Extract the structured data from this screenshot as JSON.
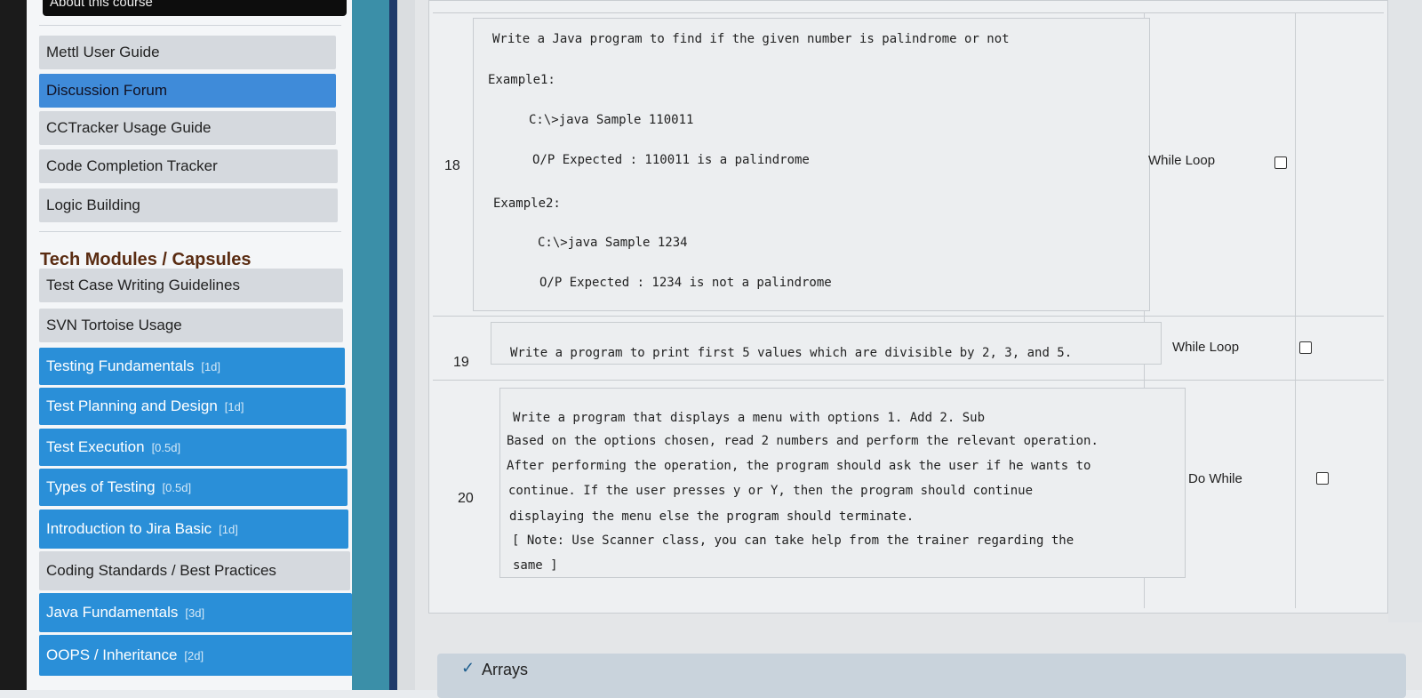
{
  "sidebar": {
    "about_label": "About this course",
    "items": [
      {
        "label": "Mettl User Guide",
        "tag": ""
      },
      {
        "label": "Discussion Forum",
        "tag": ""
      },
      {
        "label": "CCTracker Usage Guide",
        "tag": ""
      },
      {
        "label": "Code Completion Tracker",
        "tag": ""
      },
      {
        "label": "Logic Building",
        "tag": ""
      }
    ],
    "section_title": "Tech Modules / Capsules",
    "modules": [
      {
        "label": "Test Case Writing Guidelines",
        "tag": ""
      },
      {
        "label": "SVN Tortoise Usage",
        "tag": ""
      },
      {
        "label": "Testing Fundamentals",
        "tag": "[1d]"
      },
      {
        "label": "Test Planning and Design",
        "tag": "[1d]"
      },
      {
        "label": "Test Execution",
        "tag": "[0.5d]"
      },
      {
        "label": "Types of Testing",
        "tag": "[0.5d]"
      },
      {
        "label": "Introduction to Jira Basic",
        "tag": "[1d]"
      },
      {
        "label": "Coding Standards / Best Practices",
        "tag": ""
      },
      {
        "label": "Java Fundamentals",
        "tag": "[3d]"
      },
      {
        "label": "OOPS / Inheritance",
        "tag": "[2d]"
      }
    ]
  },
  "table": {
    "rows": [
      {
        "sno": "18",
        "lines": [
          "Write a Java program to find if the given number is palindrome or not",
          "Example1:",
          "C:\\>java Sample 110011",
          "O/P Expected : 110011 is a palindrome",
          "Example2:",
          "C:\\>java Sample 1234",
          "O/P Expected : 1234 is not a palindrome"
        ],
        "topic": "While Loop"
      },
      {
        "sno": "19",
        "lines": [
          "Write a program to print first 5 values which are divisible by 2, 3, and 5."
        ],
        "topic": "While Loop"
      },
      {
        "sno": "20",
        "lines": [
          "Write a program that displays a menu with options 1. Add 2. Sub",
          "Based on the options chosen, read 2 numbers and perform the relevant operation.",
          "After performing the operation, the program should ask the user if he wants to",
          "continue. If the user presses y or Y, then the program should continue",
          "displaying the menu else the program should terminate.",
          "[ Note: Use Scanner class, you can take help from the trainer regarding the",
          "same ]"
        ],
        "topic": "Do While"
      }
    ]
  },
  "next_section": {
    "label": "Arrays",
    "icon": "chevron-down-icon"
  }
}
